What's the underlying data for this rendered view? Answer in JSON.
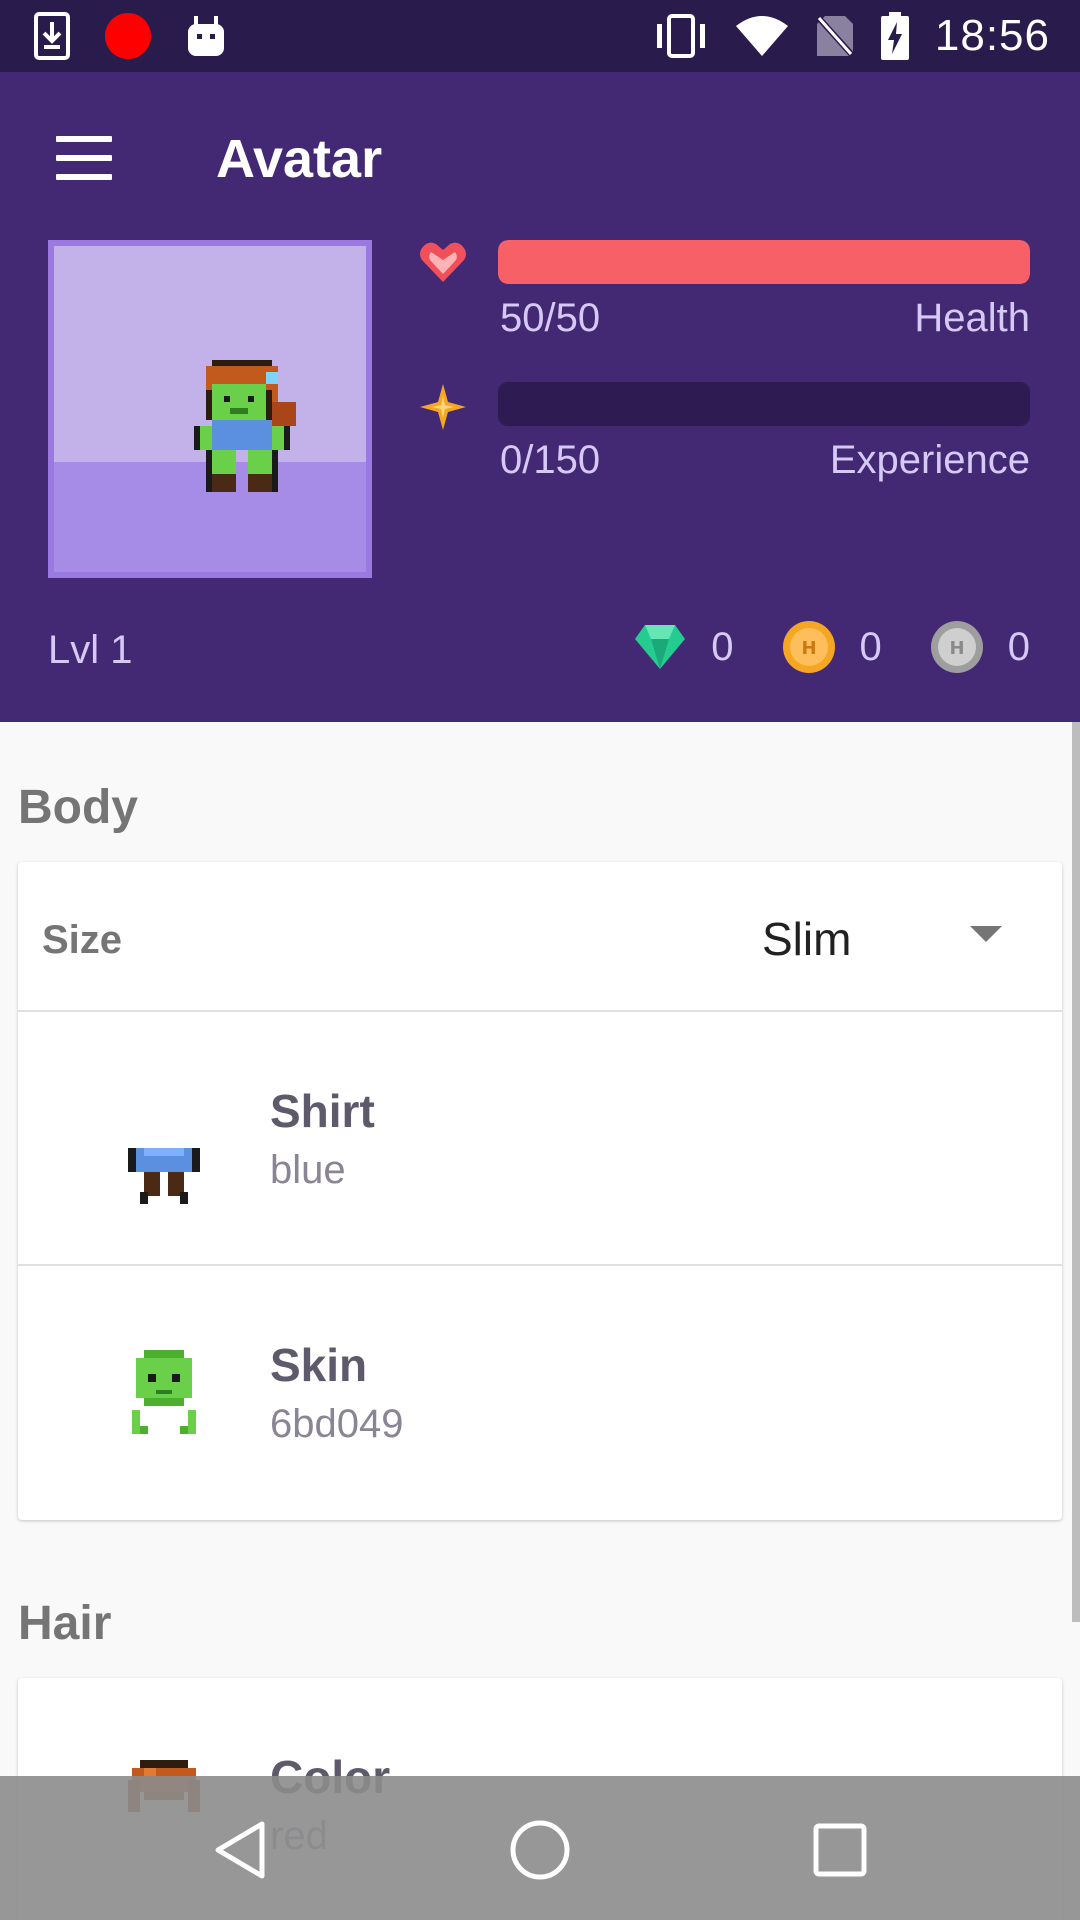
{
  "status_bar": {
    "time": "18:56",
    "left_icons": [
      "download-icon",
      "record-icon",
      "android-debug-icon"
    ],
    "right_icons": [
      "vibrate-icon",
      "wifi-icon",
      "no-sim-icon",
      "battery-charging-icon"
    ]
  },
  "header": {
    "title": "Avatar",
    "menu_icon": "hamburger-menu-icon",
    "health": {
      "icon": "heart-icon",
      "current": 50,
      "max": 50,
      "text": "50/50",
      "label": "Health",
      "fraction": 1.0,
      "color": "#f86067"
    },
    "experience": {
      "icon": "star-icon",
      "current": 0,
      "max": 150,
      "text": "0/150",
      "label": "Experience",
      "fraction": 0.0,
      "color": "#f5a623"
    },
    "level": "Lvl 1",
    "currencies": {
      "gems": {
        "icon": "gem-icon",
        "amount": "0"
      },
      "gold": {
        "icon": "gold-coin-icon",
        "amount": "0"
      },
      "hourglass": {
        "icon": "silver-coin-icon",
        "amount": "0"
      }
    },
    "colors": {
      "primary": "#432874",
      "dark": "#2a1b4d",
      "frame": "#9a7ae0"
    }
  },
  "body_section": {
    "title": "Body",
    "size": {
      "label": "Size",
      "value": "Slim"
    },
    "items": [
      {
        "title": "Shirt",
        "value": "blue",
        "icon": "shirt-icon"
      },
      {
        "title": "Skin",
        "value": "6bd049",
        "icon": "skin-icon"
      }
    ]
  },
  "hair_section": {
    "title": "Hair",
    "items": [
      {
        "title": "Color",
        "value": "red",
        "icon": "hair-icon"
      }
    ]
  },
  "nav_bar": {
    "buttons": [
      "back-icon",
      "home-icon",
      "recents-icon"
    ]
  }
}
